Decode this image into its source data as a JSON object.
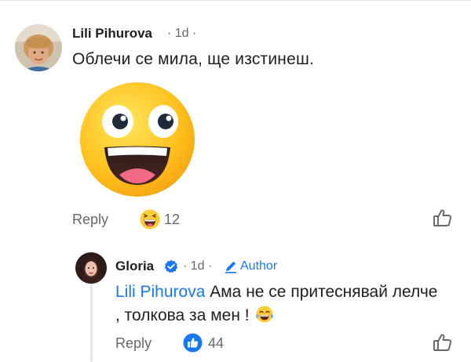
{
  "comment": {
    "author": "Lili Pihurova",
    "time": "· 1d ·",
    "text": "Облечи се мила, ще изстинеш.",
    "reply_label": "Reply",
    "reaction_count": "12",
    "reaction_icon": "laughing-face-icon",
    "sticker": "grinning-face-sticker"
  },
  "reply": {
    "author": "Gloria",
    "time": "· 1d ·",
    "badge_label": "Author",
    "mention": "Lili Pihurova",
    "text": " Ама не се притеснявай лелче , толкова за мен ! ",
    "reply_label": "Reply",
    "reaction_count": "44",
    "reaction_icon": "thumbs-up-reaction-icon"
  },
  "colors": {
    "text": "#1c1e21",
    "secondary": "#65676b",
    "link": "#1877f2"
  }
}
